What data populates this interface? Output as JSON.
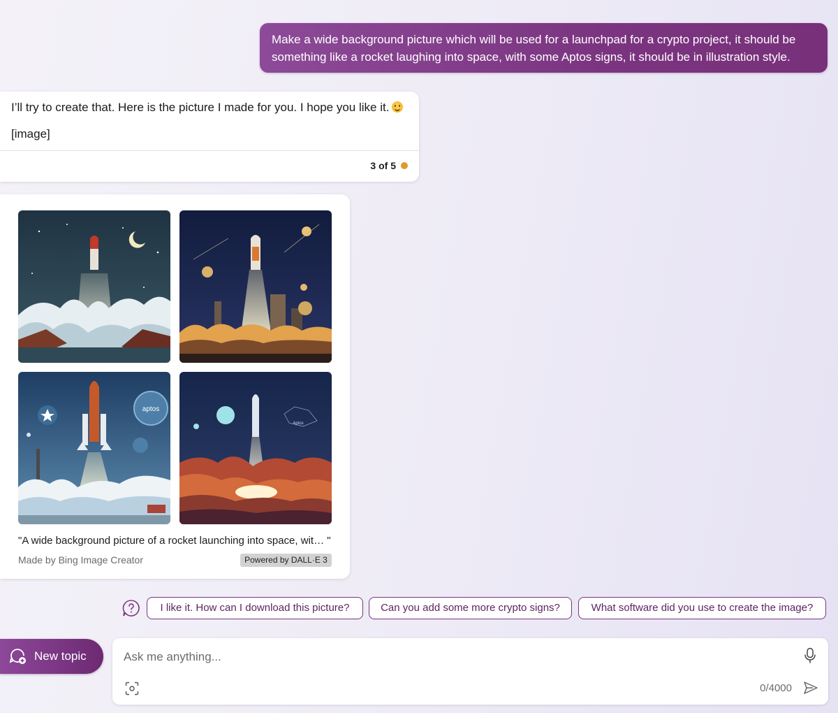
{
  "user_message": {
    "text": "Make a wide background picture which will be used for a launchpad for a crypto project, it should be something like a rocket laughing into space, with some Aptos signs, it should be in illustration style."
  },
  "bot_message": {
    "text": "I’ll try to create that. Here is the picture I made for you. I hope you like it.",
    "emoji": "smiling-face-emoji",
    "image_placeholder": "[image]",
    "counter": "3 of 5",
    "counter_dot_color": "#e09a2c"
  },
  "image_card": {
    "caption": "\"A wide background picture of a rocket launching into space, wit…  \"",
    "made_by": "Made by Bing Image Creator",
    "powered_by": "Powered by DALL·E 3",
    "images": [
      {
        "icon": "rocket-launch-dark-clouds-illustration"
      },
      {
        "icon": "rocket-launch-night-city-illustration"
      },
      {
        "icon": "shuttle-launch-aptos-illustration",
        "label": "aptos"
      },
      {
        "icon": "rocket-launch-red-sunset-illustration",
        "label": "Aptos"
      }
    ]
  },
  "suggestions": {
    "help_icon": "question-bubble-icon",
    "chips": [
      "I like it. How can I download this picture?",
      "Can you add some more crypto signs?",
      "What software did you use to create the image?"
    ]
  },
  "composer": {
    "new_topic_label": "New topic",
    "placeholder": "Ask me anything...",
    "char_count": "0/4000"
  },
  "colors": {
    "accent": "#7b3580",
    "user_bubble": "#8c4a98"
  }
}
